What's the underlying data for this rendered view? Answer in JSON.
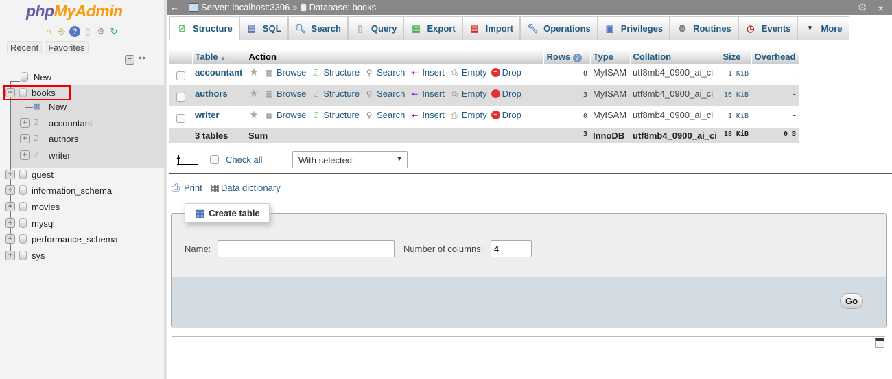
{
  "sidebar": {
    "logo_php": "php",
    "logo_myadmin": "MyAdmin",
    "tabs": [
      "Recent",
      "Favorites"
    ],
    "tree": [
      {
        "label": "New",
        "kind": "new"
      },
      {
        "label": "books",
        "kind": "db",
        "expanded": true,
        "selected": true,
        "children": [
          {
            "label": "New",
            "kind": "new-table"
          },
          {
            "label": "accountant",
            "kind": "table"
          },
          {
            "label": "authors",
            "kind": "table"
          },
          {
            "label": "writer",
            "kind": "table"
          }
        ]
      },
      {
        "label": "guest",
        "kind": "db"
      },
      {
        "label": "information_schema",
        "kind": "db"
      },
      {
        "label": "movies",
        "kind": "db"
      },
      {
        "label": "mysql",
        "kind": "db"
      },
      {
        "label": "performance_schema",
        "kind": "db"
      },
      {
        "label": "sys",
        "kind": "db"
      }
    ]
  },
  "breadcrumb": {
    "server": "Server: localhost:3306",
    "sep": "»",
    "database": "Database: books"
  },
  "tabs": [
    {
      "label": "Structure",
      "icon": "structure-icon",
      "active": true
    },
    {
      "label": "SQL",
      "icon": "sql-icon"
    },
    {
      "label": "Search",
      "icon": "search-icon"
    },
    {
      "label": "Query",
      "icon": "query-icon"
    },
    {
      "label": "Export",
      "icon": "export-icon"
    },
    {
      "label": "Import",
      "icon": "import-icon"
    },
    {
      "label": "Operations",
      "icon": "wrench-icon"
    },
    {
      "label": "Privileges",
      "icon": "privileges-icon"
    },
    {
      "label": "Routines",
      "icon": "routines-icon"
    },
    {
      "label": "Events",
      "icon": "clock-icon"
    },
    {
      "label": "More",
      "icon": "caret-down-icon"
    }
  ],
  "table": {
    "headers": {
      "table": "Table",
      "action": "Action",
      "rows": "Rows",
      "type": "Type",
      "collation": "Collation",
      "size": "Size",
      "overhead": "Overhead"
    },
    "actions": [
      "Browse",
      "Structure",
      "Search",
      "Insert",
      "Empty",
      "Drop"
    ],
    "rows": [
      {
        "name": "accountant",
        "rows": "0",
        "type": "MyISAM",
        "collation": "utf8mb4_0900_ai_ci",
        "size": "1 KiB",
        "overhead": "-"
      },
      {
        "name": "authors",
        "rows": "3",
        "type": "MyISAM",
        "collation": "utf8mb4_0900_ai_ci",
        "size": "16 KiB",
        "overhead": "-"
      },
      {
        "name": "writer",
        "rows": "0",
        "type": "MyISAM",
        "collation": "utf8mb4_0900_ai_ci",
        "size": "1 KiB",
        "overhead": "-"
      }
    ],
    "footer": {
      "tables": "3 tables",
      "sum": "Sum",
      "rows": "3",
      "type": "InnoDB",
      "collation": "utf8mb4_0900_ai_ci",
      "size": "18 KiB",
      "overhead": "0 B"
    }
  },
  "bulk": {
    "check_all": "Check all",
    "with_selected": "With selected:"
  },
  "links": {
    "print": "Print",
    "data_dictionary": "Data dictionary"
  },
  "create_table": {
    "legend": "Create table",
    "name_label": "Name:",
    "name_value": "",
    "columns_label": "Number of columns:",
    "columns_value": "4",
    "go": "Go"
  }
}
